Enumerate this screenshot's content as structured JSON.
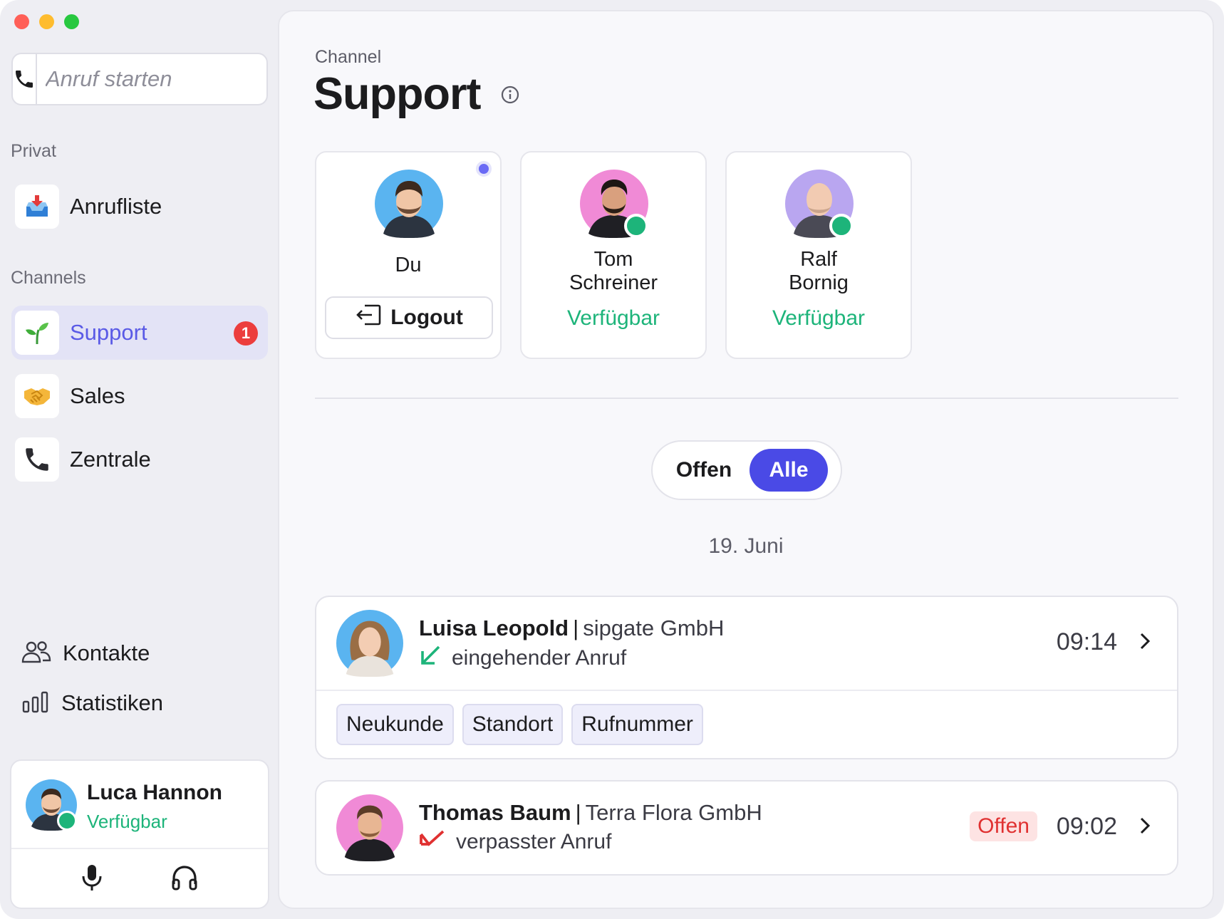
{
  "window": {
    "controls": [
      "close",
      "minimize",
      "zoom"
    ]
  },
  "sidebar": {
    "call_input": {
      "placeholder": "Anruf starten",
      "icon": "phone-icon"
    },
    "sections": {
      "private_label": "Privat",
      "channels_label": "Channels"
    },
    "private_items": [
      {
        "label": "Anrufliste",
        "icon": "inbox-tray-icon"
      }
    ],
    "channel_items": [
      {
        "label": "Support",
        "icon": "seedling-icon",
        "active": true,
        "badge": "1"
      },
      {
        "label": "Sales",
        "icon": "handshake-icon"
      },
      {
        "label": "Zentrale",
        "icon": "telephone-receiver-icon"
      }
    ],
    "bottom_nav": [
      {
        "label": "Kontakte",
        "icon": "people-icon"
      },
      {
        "label": "Statistiken",
        "icon": "bar-chart-icon"
      }
    ],
    "user": {
      "name": "Luca Hannon",
      "status": "Verfügbar",
      "actions": [
        "microphone-icon",
        "headphones-icon"
      ]
    }
  },
  "main": {
    "eyebrow": "Channel",
    "title": "Support",
    "members": [
      {
        "name": "Du",
        "is_self": true,
        "action_label": "Logout",
        "avatar_bg": "#5ab4f0"
      },
      {
        "name_line1": "Tom",
        "name_line2": "Schreiner",
        "status": "Verfügbar",
        "avatar_bg": "#f08ad6"
      },
      {
        "name_line1": "Ralf",
        "name_line2": "Bornig",
        "status": "Verfügbar",
        "avatar_bg": "#b9a6f0"
      }
    ],
    "filter": {
      "options": [
        "Offen",
        "Alle"
      ],
      "selected": "Alle"
    },
    "date_heading": "19. Juni",
    "calls": [
      {
        "name": "Luisa Leopold",
        "company": "sipgate GmbH",
        "direction_icon": "incoming-arrow-icon",
        "type_label": "eingehender Anruf",
        "time": "09:14",
        "tags": [
          "Neukunde",
          "Standort",
          "Rufnummer"
        ],
        "avatar_bg": "#5ab4f0"
      },
      {
        "name": "Thomas Baum",
        "company": "Terra Flora GmbH",
        "direction_icon": "missed-call-icon",
        "type_label": "verpasster Anruf",
        "status": "Offen",
        "time": "09:02",
        "avatar_bg": "#f08ad6"
      }
    ]
  },
  "colors": {
    "accent": "#4a4ae6",
    "available": "#1db47a",
    "badge": "#ec3d3d",
    "missed": "#e03131"
  }
}
